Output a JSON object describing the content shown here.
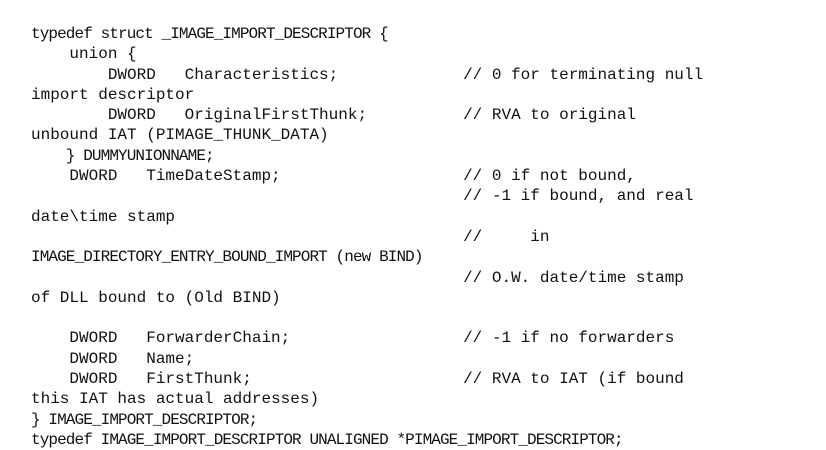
{
  "code_lines": [
    {
      "text": "typedef struct _IMAGE_IMPORT_DESCRIPTOR {",
      "narrow": true
    },
    {
      "text": "    union {",
      "narrow": false
    },
    {
      "text": "        DWORD   Characteristics;             // 0 for terminating null",
      "narrow": false
    },
    {
      "text": "import descriptor",
      "narrow": false
    },
    {
      "text": "        DWORD   OriginalFirstThunk;          // RVA to original",
      "narrow": false
    },
    {
      "text": "unbound IAT (PIMAGE_THUNK_DATA)",
      "narrow": false
    },
    {
      "text": "    } DUMMYUNIONNAME;",
      "narrow": true
    },
    {
      "text": "    DWORD   TimeDateStamp;                   // 0 if not bound,",
      "narrow": false
    },
    {
      "text": "                                             // -1 if bound, and real",
      "narrow": false
    },
    {
      "text": "date\\time stamp",
      "narrow": false
    },
    {
      "text": "                                             //     in",
      "narrow": false
    },
    {
      "text": "IMAGE_DIRECTORY_ENTRY_BOUND_IMPORT (new BIND)",
      "narrow": true
    },
    {
      "text": "                                             // O.W. date/time stamp",
      "narrow": false
    },
    {
      "text": "of DLL bound to (Old BIND)",
      "narrow": false
    },
    {
      "text": "",
      "narrow": false
    },
    {
      "text": "    DWORD   ForwarderChain;                  // -1 if no forwarders",
      "narrow": false
    },
    {
      "text": "    DWORD   Name;",
      "narrow": false
    },
    {
      "text": "    DWORD   FirstThunk;                      // RVA to IAT (if bound",
      "narrow": false
    },
    {
      "text": "this IAT has actual addresses)",
      "narrow": false
    },
    {
      "text": "} IMAGE_IMPORT_DESCRIPTOR;",
      "narrow": true
    },
    {
      "text": "typedef IMAGE_IMPORT_DESCRIPTOR UNALIGNED *PIMAGE_IMPORT_DESCRIPTOR;",
      "narrow": true
    }
  ]
}
